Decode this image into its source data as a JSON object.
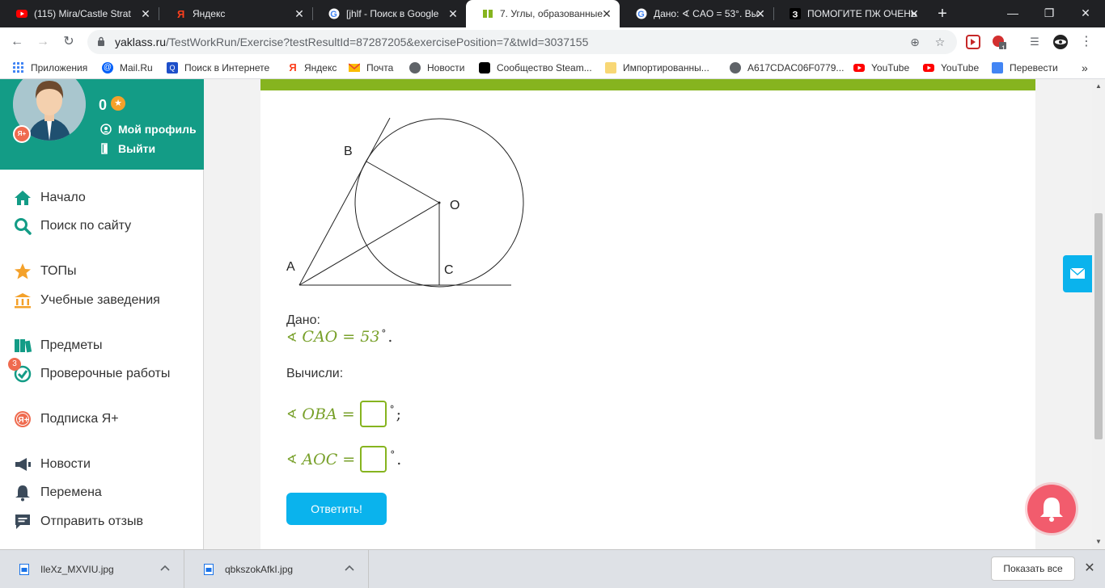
{
  "browser": {
    "tabs": [
      {
        "title": "(115) Mira/Castle Strat",
        "icon": "youtube-icon"
      },
      {
        "title": "Яндекс",
        "icon": "yandex-icon"
      },
      {
        "title": "[jhlf - Поиск в Google",
        "icon": "google-icon"
      },
      {
        "title": "7. Углы, образованные",
        "icon": "yaklass-icon",
        "active": true
      },
      {
        "title": "Дано: ∢ CAO = 53°. Вы",
        "icon": "google-icon"
      },
      {
        "title": "ПОМОГИТЕ ПЖ ОЧЕНЬ",
        "icon": "znanija-icon"
      }
    ],
    "url_domain": "yaklass.ru",
    "url_path": "/TestWorkRun/Exercise?testResultId=87287205&exercisePosition=7&twId=3037155",
    "bookmarks": [
      {
        "label": "Приложения",
        "icon": "apps-icon"
      },
      {
        "label": "Mail.Ru",
        "icon": "mailru-icon"
      },
      {
        "label": "Поиск в Интернете",
        "icon": "search-icon"
      },
      {
        "label": "Яндекс",
        "icon": "yandex-icon"
      },
      {
        "label": "Почта",
        "icon": "mail-icon"
      },
      {
        "label": "Новости",
        "icon": "globe-icon"
      },
      {
        "label": "Сообщество Steam...",
        "icon": "steam-icon"
      },
      {
        "label": "Импортированны...",
        "icon": "folder-icon"
      },
      {
        "label": "A617CDAC06F0779...",
        "icon": "globe-icon"
      },
      {
        "label": "YouTube",
        "icon": "youtube-icon"
      },
      {
        "label": "YouTube",
        "icon": "youtube-icon"
      },
      {
        "label": "Перевести",
        "icon": "translate-icon"
      }
    ],
    "extension_badge": "1",
    "colors": {
      "tabstrip": "#202124",
      "omnibox": "#f1f3f4"
    }
  },
  "profile": {
    "points": "0",
    "my_profile": "Мой профиль",
    "logout": "Выйти",
    "badge": "Я+"
  },
  "menu": [
    {
      "label": "Начало",
      "icon": "home-icon"
    },
    {
      "label": "Поиск по сайту",
      "icon": "search-icon"
    },
    {
      "label": "ТОПы",
      "icon": "star-icon"
    },
    {
      "label": "Учебные заведения",
      "icon": "institution-icon"
    },
    {
      "label": "Предметы",
      "icon": "books-icon"
    },
    {
      "label": "Проверочные работы",
      "icon": "check-icon",
      "badge": "3"
    },
    {
      "label": "Подписка Я+",
      "icon": "yaplus-icon"
    },
    {
      "label": "Новости",
      "icon": "megaphone-icon"
    },
    {
      "label": "Перемена",
      "icon": "bell-icon"
    },
    {
      "label": "Отправить отзыв",
      "icon": "feedback-icon"
    }
  ],
  "exercise": {
    "figure_labels": {
      "B": "B",
      "O": "O",
      "A": "A",
      "C": "C"
    },
    "given_label": "Дано:",
    "given_expr": "CAO = 53",
    "compute_label": "Вычисли:",
    "q1_expr": "OBA =",
    "q1_value": "",
    "q1_suffix": ";",
    "q2_expr": "AOC =",
    "q2_value": "",
    "q2_suffix": ".",
    "angle_symbol": "∢",
    "degree_symbol": "°",
    "submit_label": "Ответить!"
  },
  "downloads": {
    "items": [
      {
        "name": "IleXz_MXVIU.jpg"
      },
      {
        "name": "qbkszokAfkI.jpg"
      }
    ],
    "show_all": "Показать все"
  },
  "theme": {
    "accent_teal": "#139c86",
    "accent_green": "#86b41f",
    "math_green": "#78a02a",
    "button_blue": "#0ab3ed",
    "bell_red": "#f25c6d"
  }
}
